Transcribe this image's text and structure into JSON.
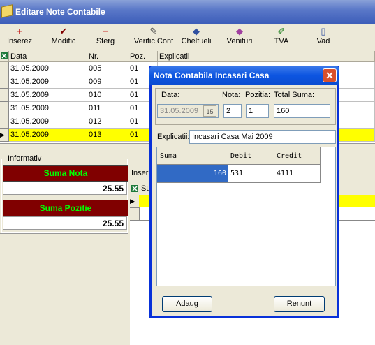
{
  "window": {
    "title": "Editare Note Contabile"
  },
  "toolbar": {
    "items": [
      {
        "label": "Inserez",
        "icon": "plus-icon"
      },
      {
        "label": "Modific",
        "icon": "checkmark-icon"
      },
      {
        "label": "Sterg",
        "icon": "minus-icon"
      },
      {
        "label": "Verific Cont",
        "icon": "verify-icon"
      },
      {
        "label": "Cheltueli",
        "icon": "expenses-icon"
      },
      {
        "label": "Venituri",
        "icon": "income-icon"
      },
      {
        "label": "TVA",
        "icon": "vat-icon"
      },
      {
        "label": "Vad",
        "icon": "view-icon"
      }
    ]
  },
  "grid": {
    "columns": [
      "Data",
      "Nr.",
      "Poz.",
      "Explicatii"
    ],
    "rows": [
      {
        "data": "31.05.2009",
        "nr": "005",
        "poz": "01"
      },
      {
        "data": "31.05.2009",
        "nr": "009",
        "poz": "01"
      },
      {
        "data": "31.05.2009",
        "nr": "010",
        "poz": "01"
      },
      {
        "data": "31.05.2009",
        "nr": "011",
        "poz": "01"
      },
      {
        "data": "31.05.2009",
        "nr": "012",
        "poz": "01"
      },
      {
        "data": "31.05.2009",
        "nr": "013",
        "poz": "01"
      }
    ]
  },
  "informativ": {
    "legend": "Informativ",
    "suma_nota_label": "Suma Nota",
    "suma_nota_value": "25.55",
    "suma_pozitie_label": "Suma Pozitie",
    "suma_pozitie_value": "25.55"
  },
  "lower": {
    "insert_label": "Insere",
    "col_label": "Su"
  },
  "dialog": {
    "title": "Nota Contabila Incasari Casa",
    "labels": {
      "data": "Data:",
      "nota": "Nota:",
      "pozitia": "Pozitia:",
      "total": "Total Suma:",
      "explicatii": "Explicatii:"
    },
    "values": {
      "data": "31.05.2009",
      "calendar": "15",
      "nota": "2",
      "pozitia": "1",
      "total": "160",
      "explicatii": "Incasari Casa Mai      2009"
    },
    "columns": [
      "Suma",
      "Debit",
      "Credit"
    ],
    "rows": [
      {
        "suma": "160",
        "debit": "531",
        "credit": "4111"
      }
    ],
    "buttons": {
      "ok": "Adaug",
      "cancel": "Renunt"
    }
  }
}
